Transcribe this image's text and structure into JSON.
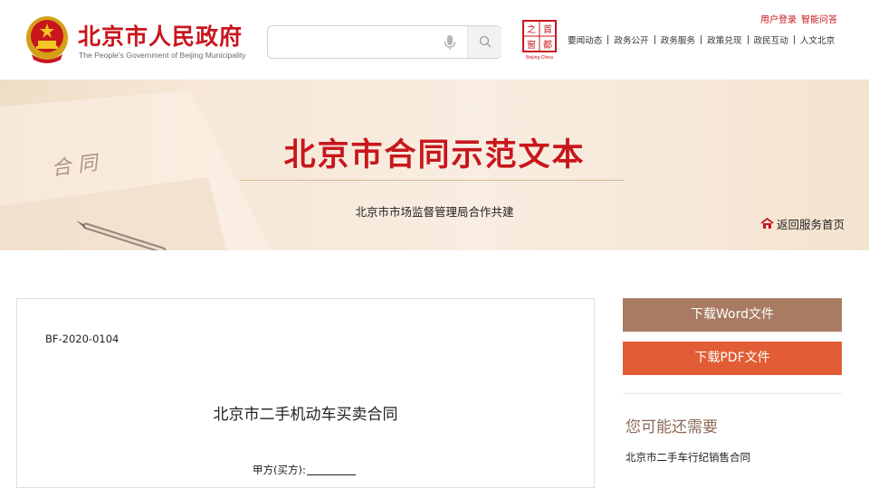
{
  "header": {
    "brand_cn": "北京市人民政府",
    "brand_en": "The People's Government of Beijing Municipality",
    "search": {
      "value": "",
      "placeholder": ""
    },
    "seal_text": "Beijing·China",
    "util_links": {
      "login": "用户登录",
      "qa": "智能问答"
    },
    "nav": [
      "要闻动态",
      "政务公开",
      "政务服务",
      "政策兑现",
      "政民互动",
      "人文北京"
    ]
  },
  "banner": {
    "title": "北京市合同示范文本",
    "subtitle": "北京市市场监督管理局合作共建",
    "back_home": "返回服务首页",
    "deco_text": "合 同"
  },
  "document": {
    "code": "BF-2020-0104",
    "title": "北京市二手机动车买卖合同",
    "party_a": "甲方(买方):"
  },
  "sidebar": {
    "download_word": "下载Word文件",
    "download_pdf": "下载PDF文件",
    "heading": "您可能还需要",
    "links": [
      "北京市二手车行纪销售合同"
    ]
  },
  "colors": {
    "brand_red": "#c8161d",
    "word_btn": "#a87b62",
    "pdf_btn": "#e25d35",
    "heading": "#8b6a58"
  }
}
